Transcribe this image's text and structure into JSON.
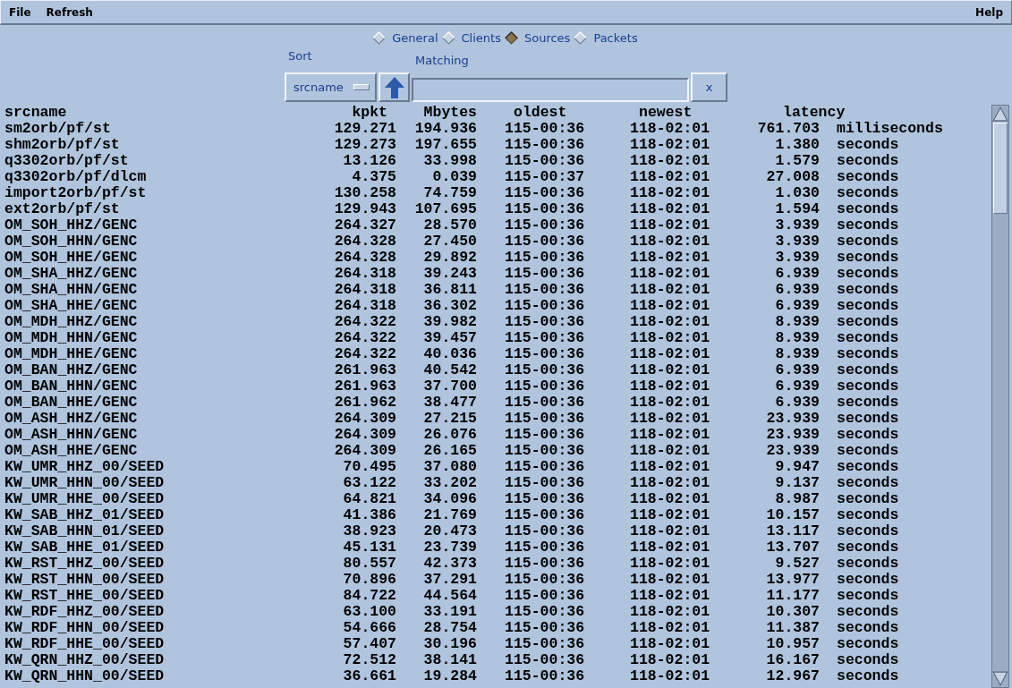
{
  "menu_bar": {
    "left": [
      "File",
      "Refresh"
    ],
    "right": "Help"
  },
  "tabs": [
    {
      "label": "General",
      "selected": false
    },
    {
      "label": "Clients",
      "selected": false
    },
    {
      "label": "Sources",
      "selected": true
    },
    {
      "label": "Packets",
      "selected": false
    }
  ],
  "sort": {
    "label": "Sort",
    "value": "srcname"
  },
  "matching": {
    "label": "Matching"
  },
  "clear_button": "x",
  "table": {
    "columns": [
      "srcname",
      "kpkt",
      "Mbytes",
      "oldest",
      "newest",
      "latency"
    ],
    "rows": [
      [
        "sm2orb/pf/st",
        "129.271",
        "194.936",
        "115-00:36",
        "118-02:01",
        "761.703",
        "milliseconds"
      ],
      [
        "shm2orb/pf/st",
        "129.273",
        "197.655",
        "115-00:36",
        "118-02:01",
        "1.380",
        "seconds"
      ],
      [
        "q3302orb/pf/st",
        "13.126",
        "33.998",
        "115-00:36",
        "118-02:01",
        "1.579",
        "seconds"
      ],
      [
        "q3302orb/pf/dlcm",
        "4.375",
        "0.039",
        "115-00:37",
        "118-02:01",
        "27.008",
        "seconds"
      ],
      [
        "import2orb/pf/st",
        "130.258",
        "74.759",
        "115-00:36",
        "118-02:01",
        "1.030",
        "seconds"
      ],
      [
        "ext2orb/pf/st",
        "129.943",
        "107.695",
        "115-00:36",
        "118-02:01",
        "1.594",
        "seconds"
      ],
      [
        "OM_SOH_HHZ/GENC",
        "264.327",
        "28.570",
        "115-00:36",
        "118-02:01",
        "3.939",
        "seconds"
      ],
      [
        "OM_SOH_HHN/GENC",
        "264.328",
        "27.450",
        "115-00:36",
        "118-02:01",
        "3.939",
        "seconds"
      ],
      [
        "OM_SOH_HHE/GENC",
        "264.328",
        "29.892",
        "115-00:36",
        "118-02:01",
        "3.939",
        "seconds"
      ],
      [
        "OM_SHA_HHZ/GENC",
        "264.318",
        "39.243",
        "115-00:36",
        "118-02:01",
        "6.939",
        "seconds"
      ],
      [
        "OM_SHA_HHN/GENC",
        "264.318",
        "36.811",
        "115-00:36",
        "118-02:01",
        "6.939",
        "seconds"
      ],
      [
        "OM_SHA_HHE/GENC",
        "264.318",
        "36.302",
        "115-00:36",
        "118-02:01",
        "6.939",
        "seconds"
      ],
      [
        "OM_MDH_HHZ/GENC",
        "264.322",
        "39.982",
        "115-00:36",
        "118-02:01",
        "8.939",
        "seconds"
      ],
      [
        "OM_MDH_HHN/GENC",
        "264.322",
        "39.457",
        "115-00:36",
        "118-02:01",
        "8.939",
        "seconds"
      ],
      [
        "OM_MDH_HHE/GENC",
        "264.322",
        "40.036",
        "115-00:36",
        "118-02:01",
        "8.939",
        "seconds"
      ],
      [
        "OM_BAN_HHZ/GENC",
        "261.963",
        "40.542",
        "115-00:36",
        "118-02:01",
        "6.939",
        "seconds"
      ],
      [
        "OM_BAN_HHN/GENC",
        "261.963",
        "37.700",
        "115-00:36",
        "118-02:01",
        "6.939",
        "seconds"
      ],
      [
        "OM_BAN_HHE/GENC",
        "261.962",
        "38.477",
        "115-00:36",
        "118-02:01",
        "6.939",
        "seconds"
      ],
      [
        "OM_ASH_HHZ/GENC",
        "264.309",
        "27.215",
        "115-00:36",
        "118-02:01",
        "23.939",
        "seconds"
      ],
      [
        "OM_ASH_HHN/GENC",
        "264.309",
        "26.076",
        "115-00:36",
        "118-02:01",
        "23.939",
        "seconds"
      ],
      [
        "OM_ASH_HHE/GENC",
        "264.309",
        "26.165",
        "115-00:36",
        "118-02:01",
        "23.939",
        "seconds"
      ],
      [
        "KW_UMR_HHZ_00/SEED",
        "70.495",
        "37.080",
        "115-00:36",
        "118-02:01",
        "9.947",
        "seconds"
      ],
      [
        "KW_UMR_HHN_00/SEED",
        "63.122",
        "33.202",
        "115-00:36",
        "118-02:01",
        "9.137",
        "seconds"
      ],
      [
        "KW_UMR_HHE_00/SEED",
        "64.821",
        "34.096",
        "115-00:36",
        "118-02:01",
        "8.987",
        "seconds"
      ],
      [
        "KW_SAB_HHZ_01/SEED",
        "41.386",
        "21.769",
        "115-00:36",
        "118-02:01",
        "10.157",
        "seconds"
      ],
      [
        "KW_SAB_HHN_01/SEED",
        "38.923",
        "20.473",
        "115-00:36",
        "118-02:01",
        "13.117",
        "seconds"
      ],
      [
        "KW_SAB_HHE_01/SEED",
        "45.131",
        "23.739",
        "115-00:36",
        "118-02:01",
        "13.707",
        "seconds"
      ],
      [
        "KW_RST_HHZ_00/SEED",
        "80.557",
        "42.373",
        "115-00:36",
        "118-02:01",
        "9.527",
        "seconds"
      ],
      [
        "KW_RST_HHN_00/SEED",
        "70.896",
        "37.291",
        "115-00:36",
        "118-02:01",
        "13.977",
        "seconds"
      ],
      [
        "KW_RST_HHE_00/SEED",
        "84.722",
        "44.564",
        "115-00:36",
        "118-02:01",
        "11.177",
        "seconds"
      ],
      [
        "KW_RDF_HHZ_00/SEED",
        "63.100",
        "33.191",
        "115-00:36",
        "118-02:01",
        "10.307",
        "seconds"
      ],
      [
        "KW_RDF_HHN_00/SEED",
        "54.666",
        "28.754",
        "115-00:36",
        "118-02:01",
        "11.387",
        "seconds"
      ],
      [
        "KW_RDF_HHE_00/SEED",
        "57.407",
        "30.196",
        "115-00:36",
        "118-02:01",
        "10.957",
        "seconds"
      ],
      [
        "KW_QRN_HHZ_00/SEED",
        "72.512",
        "38.141",
        "115-00:36",
        "118-02:01",
        "16.167",
        "seconds"
      ],
      [
        "KW_QRN_HHN_00/SEED",
        "36.661",
        "19.284",
        "115-00:36",
        "118-02:01",
        "12.967",
        "seconds"
      ]
    ]
  }
}
